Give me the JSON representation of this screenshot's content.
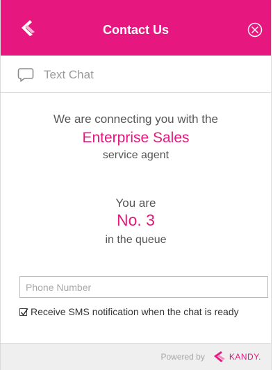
{
  "header": {
    "title": "Contact Us",
    "logo_icon": "kandy-logo-icon",
    "close_icon": "close-circle-icon"
  },
  "tab": {
    "label": "Text Chat",
    "icon": "chat-bubble-icon"
  },
  "message": {
    "line1": "We are connecting you with the",
    "department": "Enterprise Sales",
    "line3": "service agent"
  },
  "queue": {
    "prefix": "You are",
    "position": "No. 3",
    "suffix": "in the queue"
  },
  "phone_input": {
    "placeholder": "Phone Number",
    "value": ""
  },
  "sms_option": {
    "checked": true,
    "label": "Receive SMS notification when the chat is ready"
  },
  "footer": {
    "powered_by": "Powered by",
    "brand": "KANDY."
  },
  "colors": {
    "accent": "#e6177f",
    "header_text": "#ffffff",
    "muted_text": "#9a9a9a",
    "footer_bg": "#efefef"
  }
}
